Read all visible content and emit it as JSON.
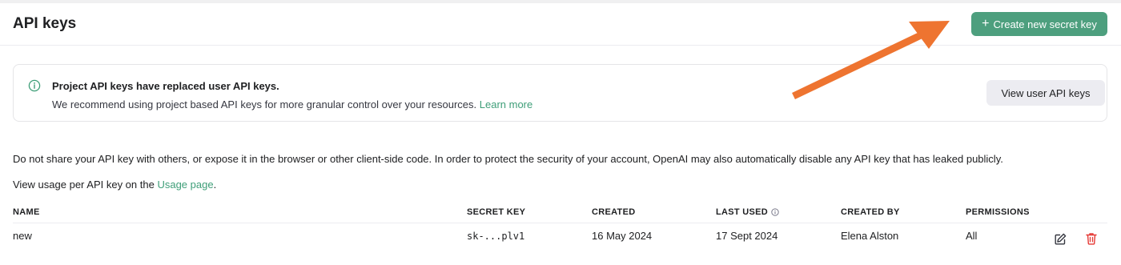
{
  "header": {
    "title": "API keys",
    "create_button": {
      "icon": "plus-icon",
      "label": "Create new secret key"
    }
  },
  "banner": {
    "icon": "info-icon",
    "title": "Project API keys have replaced user API keys.",
    "text": "We recommend using project based API keys for more granular control over your resources.",
    "link": "Learn more",
    "button": "View user API keys"
  },
  "warning_text": "Do not share your API key with others, or expose it in the browser or other client-side code. In order to protect the security of your account, OpenAI may also automatically disable any API key that has leaked publicly.",
  "usage": {
    "prefix": "View usage per API key on the",
    "link": "Usage page",
    "suffix": "."
  },
  "table": {
    "columns": [
      "NAME",
      "SECRET KEY",
      "CREATED",
      "LAST USED",
      "CREATED BY",
      "PERMISSIONS"
    ],
    "rows": [
      {
        "name": "new",
        "secret_key": "sk-...plv1",
        "created": "16 May 2024",
        "last_used": "17 Sept 2024",
        "created_by": "Elena Alston",
        "permissions": "All"
      }
    ]
  },
  "colors": {
    "accent": "#4d9f7e",
    "link": "#3e9e78",
    "annotation_arrow": "#ee7430",
    "delete": "#e53935"
  }
}
